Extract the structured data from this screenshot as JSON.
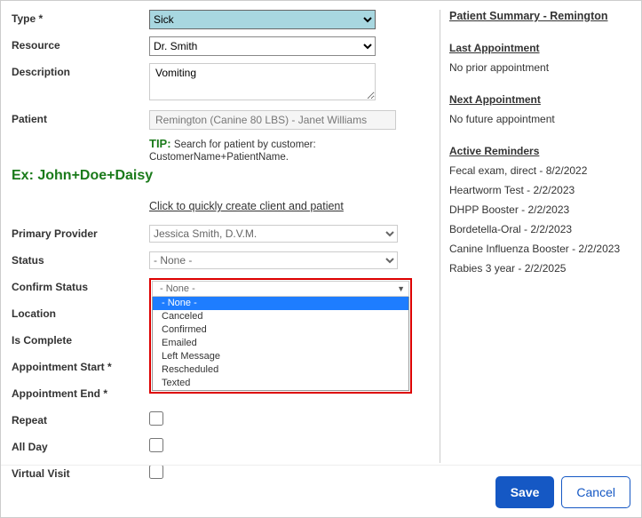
{
  "labels": {
    "type": "Type *",
    "resource": "Resource",
    "description": "Description",
    "patient": "Patient",
    "primary_provider": "Primary Provider",
    "status": "Status",
    "confirm_status": "Confirm Status",
    "location": "Location",
    "is_complete": "Is Complete",
    "appt_start": "Appointment Start *",
    "appt_end": "Appointment End *",
    "repeat": "Repeat",
    "all_day": "All Day",
    "virtual_visit": "Virtual Visit"
  },
  "values": {
    "type": "Sick",
    "resource": "Dr. Smith",
    "description": "Vomiting",
    "patient": "Remington (Canine 80 LBS) - Janet Williams",
    "primary_provider": "Jessica Smith, D.V.M.",
    "status": "- None -",
    "confirm_status_display": "- None -"
  },
  "tip": {
    "label": "TIP:",
    "text": "Search for patient by customer: CustomerName+PatientName.",
    "example": "Ex: John+Doe+Daisy"
  },
  "quick_link": "Click to quickly create client and patient",
  "confirm_options": [
    "- None -",
    "Canceled",
    "Confirmed",
    "Emailed",
    "Left Message",
    "Rescheduled",
    "Texted"
  ],
  "summary": {
    "title": "Patient Summary - Remington",
    "last_label": "Last Appointment",
    "last_value": "No prior appointment",
    "next_label": "Next Appointment",
    "next_value": "No future appointment",
    "reminders_label": "Active Reminders",
    "reminders": [
      "Fecal exam, direct - 8/2/2022",
      "Heartworm Test - 2/2/2023",
      "DHPP Booster - 2/2/2023",
      "Bordetella-Oral - 2/2/2023",
      "Canine Influenza Booster - 2/2/2023",
      "Rabies 3 year - 2/2/2025"
    ]
  },
  "buttons": {
    "save": "Save",
    "cancel": "Cancel"
  }
}
